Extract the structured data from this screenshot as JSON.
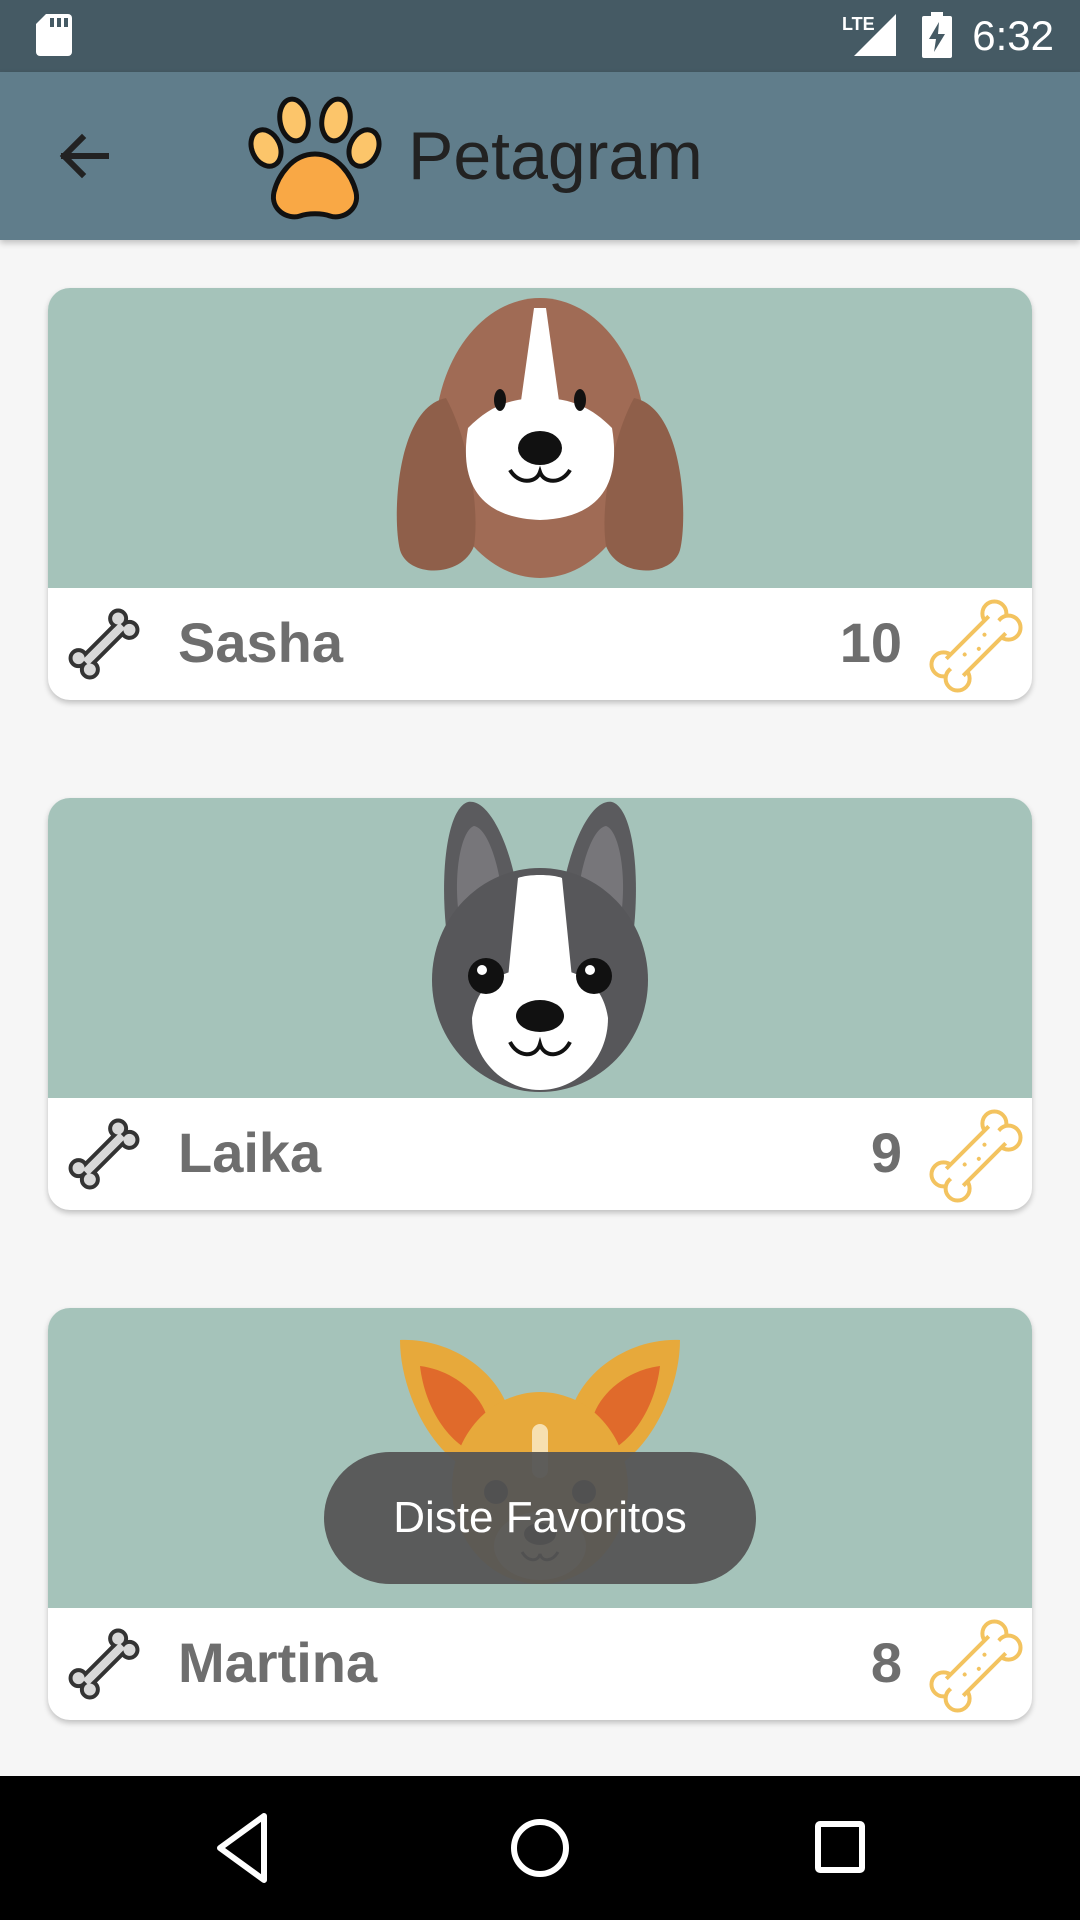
{
  "status_bar": {
    "time": "6:32",
    "network": "LTE",
    "icons": [
      "sd-card-icon",
      "lte-signal-icon",
      "battery-charging-icon"
    ]
  },
  "app_bar": {
    "title": "Petagram",
    "back_icon": "arrow-left-icon",
    "logo_icon": "paw-icon"
  },
  "pets": [
    {
      "name": "Sasha",
      "likes": "10",
      "breed_icon": "beagle-icon"
    },
    {
      "name": "Laika",
      "likes": "9",
      "breed_icon": "boston-terrier-icon"
    },
    {
      "name": "Martina",
      "likes": "8",
      "breed_icon": "chihuahua-icon"
    }
  ],
  "toast": {
    "message": "Diste Favoritos"
  },
  "nav_bar": {
    "icons": [
      "back-triangle-icon",
      "home-circle-icon",
      "recents-square-icon"
    ]
  },
  "colors": {
    "status_bar": "#455a64",
    "app_bar": "#607d8b",
    "photo_background": "#a5c3ba",
    "paw": "#f9a845",
    "bone_outline": "#f3c35f",
    "text_gray": "#6e6e6e"
  }
}
